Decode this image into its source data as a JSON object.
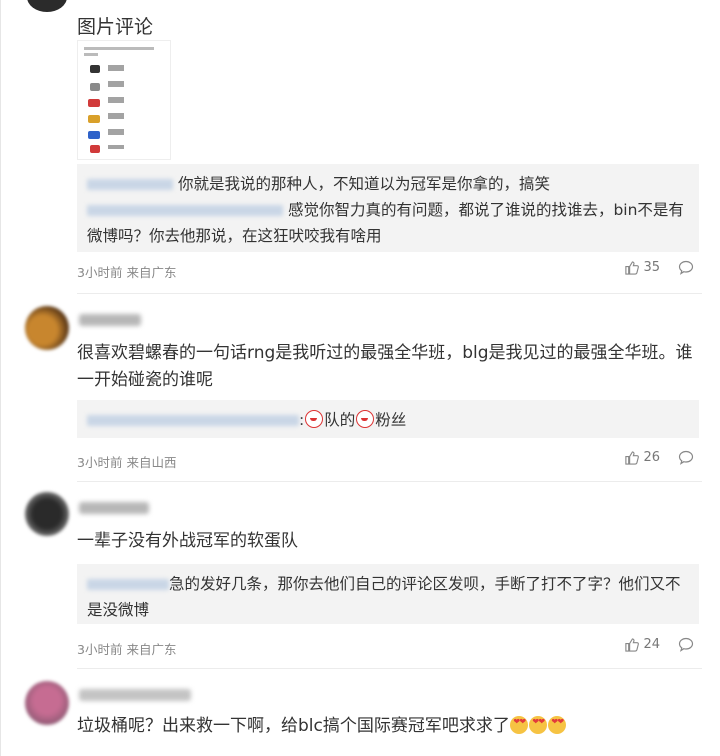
{
  "comments": [
    {
      "image_comment_label": "图片评论",
      "reply": "你就是我说的那种人，不知道以为冠军是你拿的，搞笑",
      "reply_2": "感觉你智力真的有问题，都说了谁说的找谁去，bin不是有微博吗？你去他那说，在这狂吠咬我有啥用",
      "time": "3小时前",
      "location": "来自广东",
      "likes": "35"
    },
    {
      "text": "很喜欢碧螺春的一句话rng是我听过的最强全华班，blg是我见过的最强全华班。谁一开始碰瓷的谁呢",
      "reply": ":",
      "reply_mid1": "队的",
      "reply_mid2": "粉丝",
      "time": "3小时前",
      "location": "来自山西",
      "likes": "26"
    },
    {
      "text": "一辈子没有外战冠军的软蛋队",
      "reply": "急的发好几条，那你去他们自己的评论区发呗，手断了打不了字？他们又不是没微博",
      "time": "3小时前",
      "location": "来自广东",
      "likes": "24"
    },
    {
      "text": "垃圾桶呢？出来救一下啊，给blc搞个国际赛冠军吧求求了"
    }
  ],
  "icons": {
    "like": "thumbs-up-icon",
    "reply": "comment-bubble-icon",
    "emoji_clown": "clown-emoji-icon",
    "emoji_heart_eyes": "heart-eyes-emoji-icon"
  }
}
